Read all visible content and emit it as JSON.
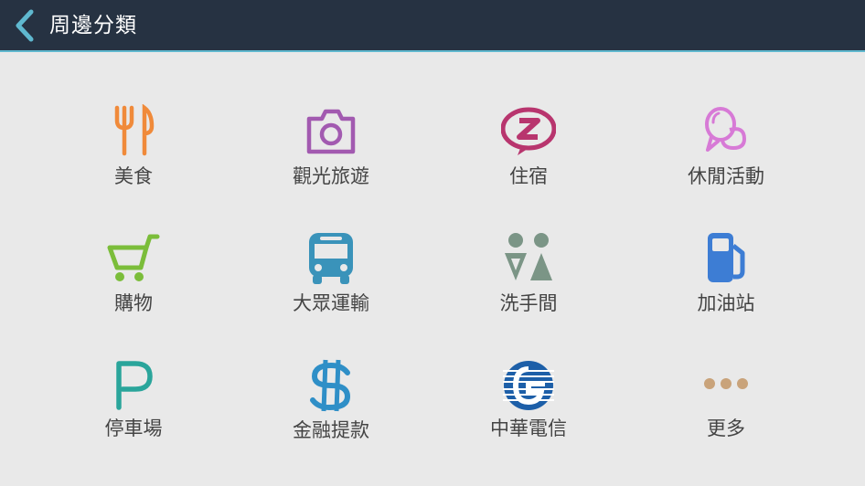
{
  "header": {
    "title": "周邊分類",
    "back_icon": "chevron-left-icon",
    "background": "#263242",
    "accent": "#5fb8cf"
  },
  "categories": [
    {
      "label": "美食",
      "icon": "fork-knife-icon",
      "color": "#f08a3a"
    },
    {
      "label": "觀光旅遊",
      "icon": "camera-icon",
      "color": "#a25ab0"
    },
    {
      "label": "住宿",
      "icon": "sleep-bubble-icon",
      "color": "#b8356e"
    },
    {
      "label": "休閒活動",
      "icon": "balloon-icon",
      "color": "#d77ad6"
    },
    {
      "label": "購物",
      "icon": "shopping-cart-icon",
      "color": "#7bbd3a"
    },
    {
      "label": "大眾運輸",
      "icon": "bus-icon",
      "color": "#3a93ba"
    },
    {
      "label": "洗手間",
      "icon": "restroom-icon",
      "color": "#7b9586"
    },
    {
      "label": "加油站",
      "icon": "fuel-pump-icon",
      "color": "#3d7dd4"
    },
    {
      "label": "停車場",
      "icon": "parking-icon",
      "color": "#2aa59b"
    },
    {
      "label": "金融提款",
      "icon": "dollar-icon",
      "color": "#2f8fc7"
    },
    {
      "label": "中華電信",
      "icon": "chunghwa-telecom-logo-icon",
      "color": "#1d5fa8"
    },
    {
      "label": "更多",
      "icon": "more-dots-icon",
      "color": "#c9a37a"
    }
  ]
}
